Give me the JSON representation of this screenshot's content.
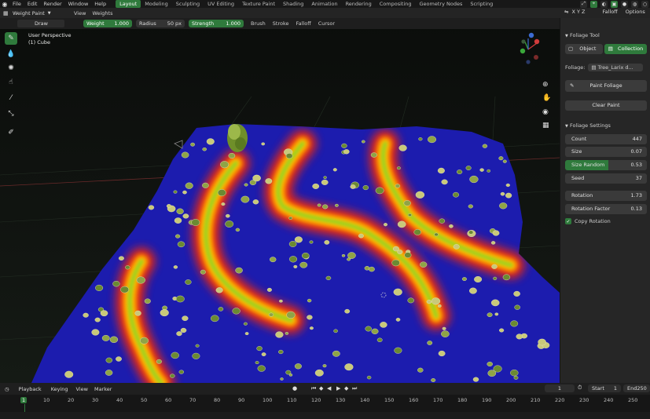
{
  "menu": [
    "File",
    "Edit",
    "Render",
    "Window",
    "Help"
  ],
  "workspaces": [
    {
      "label": "Layout",
      "active": true
    },
    {
      "label": "Modeling",
      "active": false
    },
    {
      "label": "Sculpting",
      "active": false
    },
    {
      "label": "UV Editing",
      "active": false
    },
    {
      "label": "Texture Paint",
      "active": false
    },
    {
      "label": "Shading",
      "active": false
    },
    {
      "label": "Animation",
      "active": false
    },
    {
      "label": "Rendering",
      "active": false
    },
    {
      "label": "Compositing",
      "active": false
    },
    {
      "label": "Geometry Nodes",
      "active": false
    },
    {
      "label": "Scripting",
      "active": false
    }
  ],
  "header": {
    "mode": "Weight Paint",
    "view": "View",
    "weights": "Weights"
  },
  "tool_settings": {
    "tool": "Draw",
    "weight_label": "Weight",
    "weight_value": "1.000",
    "radius_label": "Radius",
    "radius_value": "50 px",
    "strength_label": "Strength",
    "strength_value": "1.000",
    "brush": "Brush",
    "stroke": "Stroke",
    "falloff": "Falloff",
    "cursor": "Cursor"
  },
  "viewport": {
    "perspective": "User Perspective",
    "object": "(1) Cube"
  },
  "right_header": {
    "axes": "X  Y  Z",
    "falloff": "Falloff",
    "options": "Options"
  },
  "foliage_tool": {
    "section": "Foliage Tool",
    "object_btn": "Object",
    "collection_btn": "Collection",
    "foliage_label": "Foliage:",
    "foliage_value": "Tree_Larix d...",
    "paint_btn": "Paint Foliage",
    "clear_btn": "Clear Paint"
  },
  "foliage_settings": {
    "section": "Foliage Settings",
    "count_label": "Count",
    "count_value": "447",
    "size_label": "Size",
    "size_value": "0.07",
    "size_random_label": "Size Random",
    "size_random_value": "0.53",
    "size_random_fraction": 0.53,
    "seed_label": "Seed",
    "seed_value": "37",
    "rotation_label": "Rotation",
    "rotation_value": "1.73",
    "rotation_factor_label": "Rotation Factor",
    "rotation_factor_value": "0.13",
    "copy_rotation_label": "Copy Rotation",
    "copy_rotation_checked": true
  },
  "timeline": {
    "playback": "Playback",
    "keying": "Keying",
    "view": "View",
    "marker": "Marker",
    "current_frame": "1",
    "start_label": "Start",
    "start_value": "1",
    "end_label": "End",
    "end_value": "250",
    "ticks": [
      "1",
      "10",
      "20",
      "30",
      "40",
      "50",
      "60",
      "70",
      "80",
      "90",
      "100",
      "110",
      "120",
      "130",
      "140",
      "150",
      "160",
      "170",
      "180",
      "190",
      "200",
      "210",
      "220",
      "230",
      "240",
      "250"
    ]
  },
  "colors": {
    "accent": "#2f7a3c",
    "mesh_blue": "#1a1aa8",
    "weight_red": "#ff1a00",
    "weight_yellow": "#f5e500"
  }
}
